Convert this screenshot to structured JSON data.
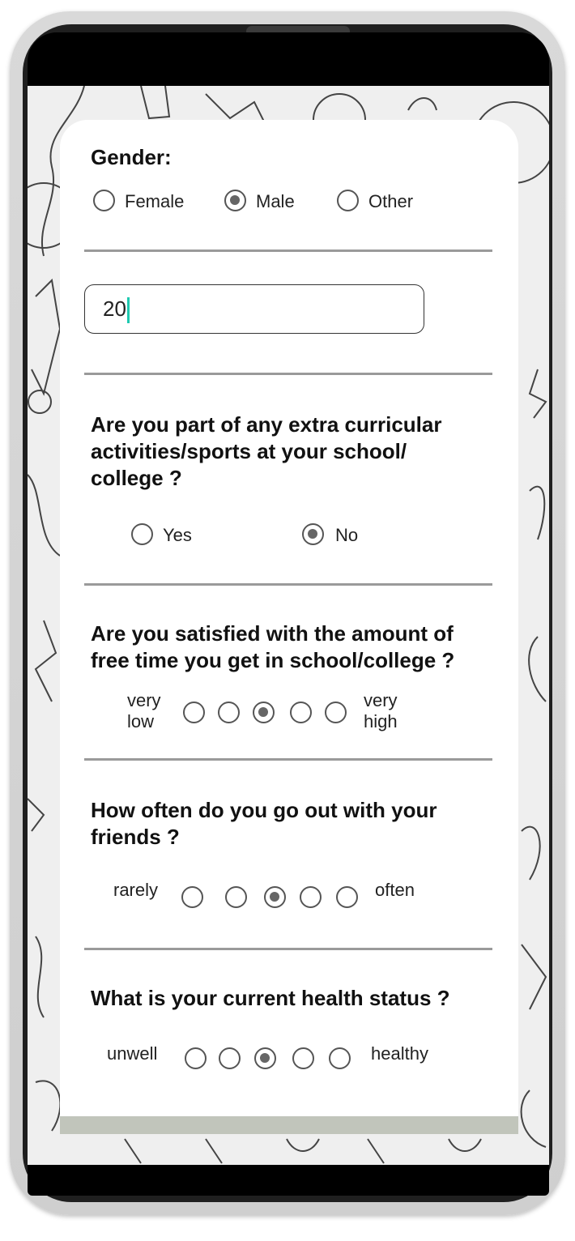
{
  "gender": {
    "title": "Gender:",
    "options": [
      "Female",
      "Male",
      "Other"
    ],
    "selected": "Male"
  },
  "age": {
    "value": "20"
  },
  "extracurricular": {
    "title": "Are you part of any extra curricular activities/sports at your school/ college ?",
    "title_lines": [
      "Are you part of any extra curricular",
      "activities/sports at your school/",
      "college ?"
    ],
    "options": [
      "Yes",
      "No"
    ],
    "selected": "No"
  },
  "free_time": {
    "title_lines": [
      "Are you satisfied with the amount of",
      "free time you get in school/college ?"
    ],
    "low_label_lines": [
      "very",
      "low"
    ],
    "high_label_lines": [
      "very",
      "high"
    ],
    "scale_points": 5,
    "selected_index": 3
  },
  "friends": {
    "title_lines": [
      "How often do you go out with your",
      "friends ?"
    ],
    "low_label": "rarely",
    "high_label": "often",
    "scale_points": 5,
    "selected_index": 3
  },
  "health": {
    "title": "What is your current health status ?",
    "low_label": "unwell",
    "high_label": "healthy",
    "scale_points": 5,
    "selected_index": 3
  },
  "colors": {
    "card": "#ffffff",
    "background": "#efefef",
    "divider": "#9a9a9a",
    "caret": "#1fc9b0",
    "bottom_bar": "#c1c5bb"
  }
}
